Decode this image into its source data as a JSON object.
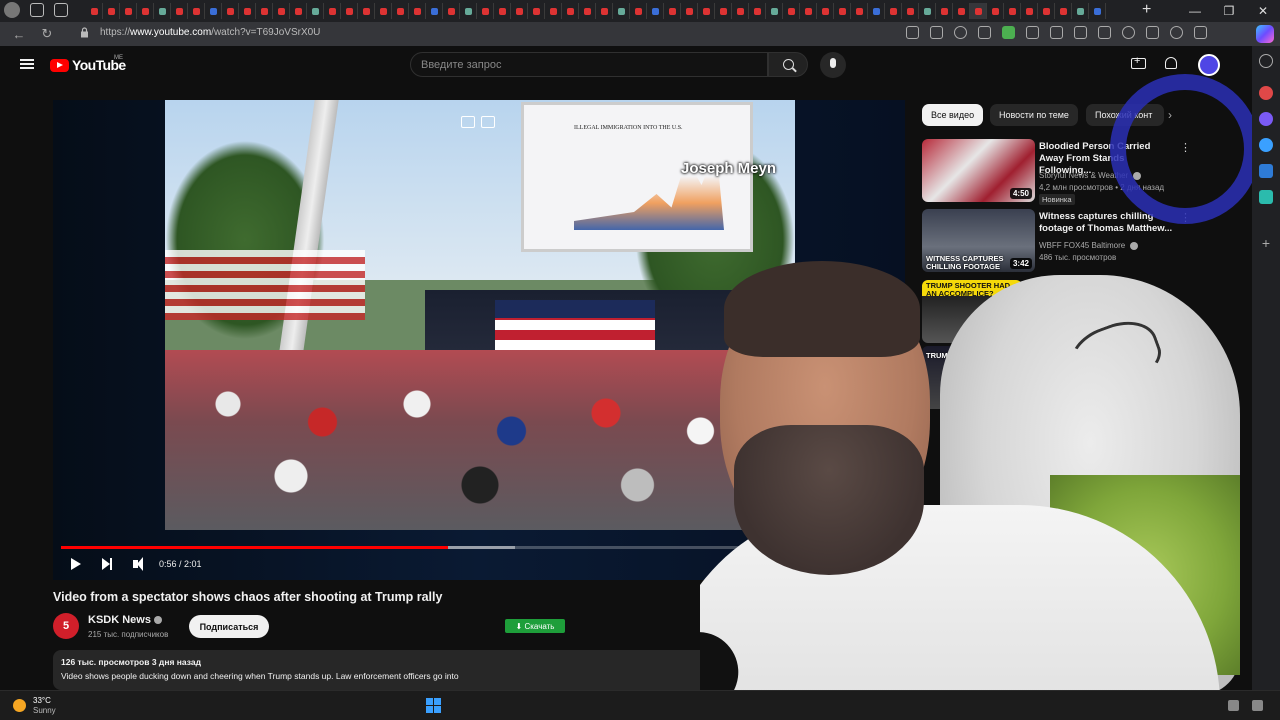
{
  "browser": {
    "url_prefix": "https://",
    "url_host": "www.youtube.com",
    "url_path": "/watch?v=T69JoVSrX0U"
  },
  "youtube": {
    "logo_text": "YouTube",
    "region": "ME",
    "search_placeholder": "Введите запрос"
  },
  "player": {
    "overlay_name": "Joseph Meyn",
    "screen_title": "ILLEGAL IMMIGRATION INTO THE U.S.",
    "time": "0:56 / 2:01",
    "progress_fraction": 0.463
  },
  "video": {
    "title": "Video from a spectator shows chaos after shooting at Trump rally",
    "channel": "KSDK News",
    "channel_avatar": "5",
    "subscribers": "215 тыс. подписчиков",
    "subscribe_label": "Подписаться",
    "download_label": "Скачать",
    "views": "126 тыс. просмотров  3 дня назад",
    "description": "Video shows people ducking down and cheering when Trump stands up. Law enforcement officers go into"
  },
  "chips": [
    "Все видео",
    "Новости по теме",
    "Похожий конт"
  ],
  "recommendations": [
    {
      "title": "Bloodied Person Carried Away From Stands Following...",
      "channel": "Storyful News & Weather",
      "meta": "4,2 млн просмотров • 2 дня назад",
      "badge": "Новинка",
      "duration": "4:50"
    },
    {
      "title": "Witness captures chilling footage of Thomas Matthew...",
      "channel": "WBFF FOX45 Baltimore",
      "meta": "486 тыс. просмотров",
      "thumb_text": "WITNESS CAPTURES CHILLING FOOTAGE",
      "duration": "3:42"
    },
    {
      "thumb_text": "TRUMP SHOOTER HAD AN ACCOMPLICE?"
    },
    {
      "thumb_text": "TRUMP APPE RNC WITH"
    }
  ],
  "taskbar": {
    "temperature": "33°C",
    "weather": "Sunny"
  },
  "colors": {
    "youtube_red": "#ff0000",
    "download_green": "#1e9e3a",
    "deco_blue": "#2a2fb5"
  }
}
